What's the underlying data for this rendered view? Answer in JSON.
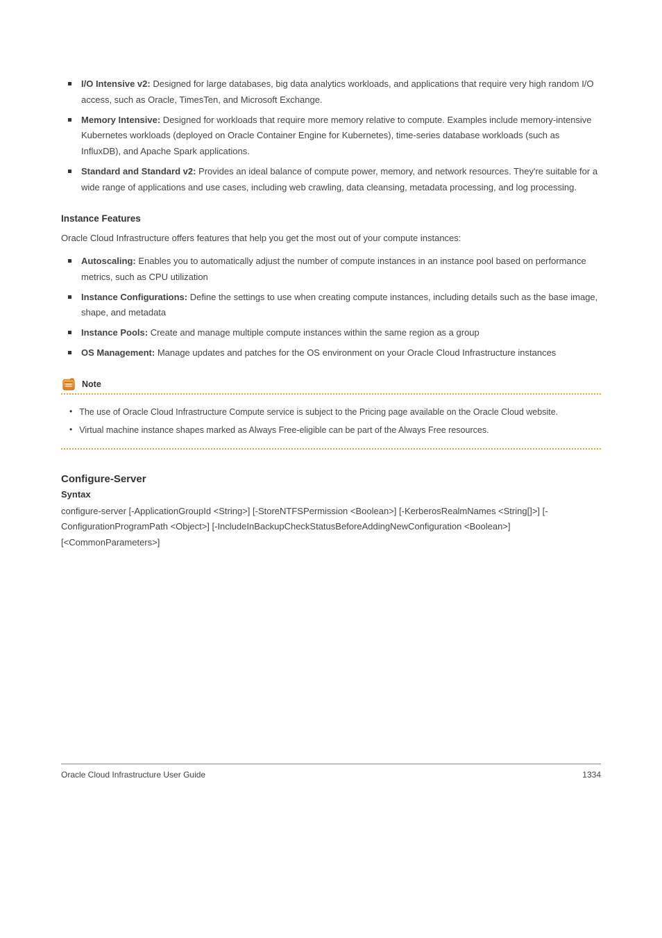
{
  "bullets": [
    {
      "label": "I/O Intensive v2:",
      "desc": "Designed for large databases, big data analytics workloads, and applications that require very high random I/O access, such as Oracle, TimesTen, and Microsoft Exchange."
    },
    {
      "label": "Memory Intensive:",
      "desc": "Designed for workloads that require more memory relative to compute. Examples include memory-intensive Kubernetes workloads (deployed on Oracle Container Engine for Kubernetes), time-series database workloads (such as InfluxDB), and Apache Spark applications."
    },
    {
      "label": "Standard and Standard v2:",
      "desc": "Provides an ideal balance of compute power, memory, and network resources. They're suitable for a wide range of applications and use cases, including web crawling, data cleansing, metadata processing, and log processing."
    }
  ],
  "section_heading": "Instance Features",
  "section_intro": "Oracle Cloud Infrastructure offers features that help you get the most out of your compute instances:",
  "features": [
    {
      "label": "Autoscaling:",
      "desc": "Enables you to automatically adjust the number of compute instances in an instance pool based on performance metrics, such as CPU utilization"
    },
    {
      "label": "Instance Configurations:",
      "desc": "Define the settings to use when creating compute instances, including details such as the base image, shape, and metadata"
    },
    {
      "label": "Instance Pools:",
      "desc": "Create and manage multiple compute instances within the same region as a group"
    },
    {
      "label": "OS Management:",
      "desc": "Manage updates and patches for the OS environment on your Oracle Cloud Infrastructure instances"
    }
  ],
  "note": {
    "label": "Note",
    "items": [
      "The use of Oracle Cloud Infrastructure Compute service is subject to the Pricing page available on the Oracle Cloud website.",
      "Virtual machine instance shapes marked as Always Free-eligible can be part of the Always Free resources."
    ]
  },
  "command": {
    "heading": "Configure-Server",
    "label": "Syntax",
    "syntax": "configure-server [-ApplicationGroupId <String>] [-StoreNTFSPermission <Boolean>] [-KerberosRealmNames <String[]>] [-ConfigurationProgramPath <Object>] [-IncludeInBackupCheckStatusBeforeAddingNewConfiguration <Boolean>] [<CommonParameters>]"
  },
  "footer": {
    "left": "Oracle Cloud Infrastructure User Guide",
    "right": "1334"
  }
}
